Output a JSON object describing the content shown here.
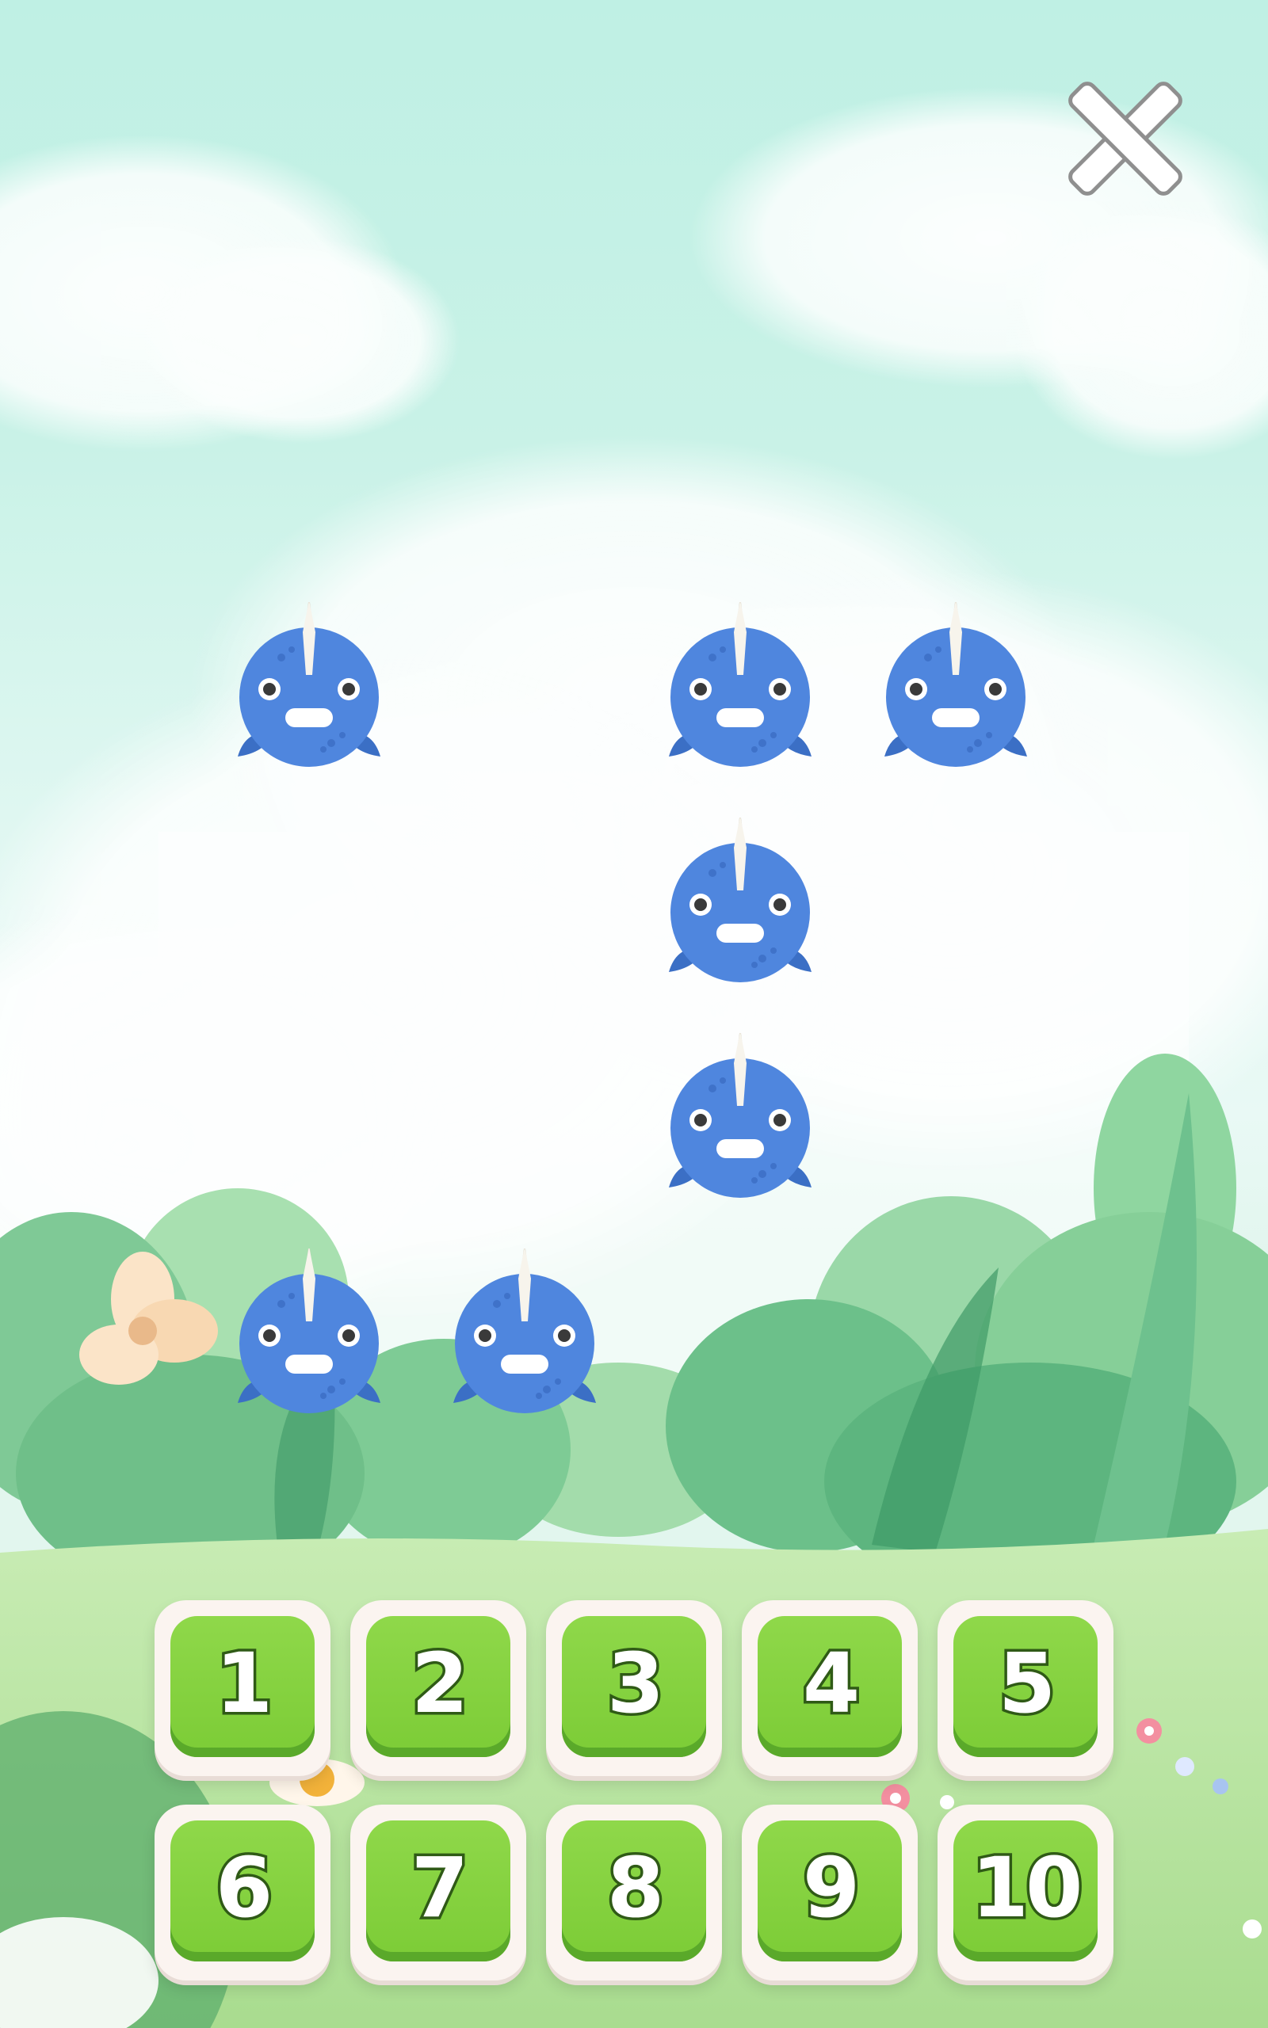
{
  "close": {
    "icon": "close-icon"
  },
  "narwhals": {
    "count": 7,
    "icon": "narwhal-icon"
  },
  "keypad": {
    "keys": [
      "1",
      "2",
      "3",
      "4",
      "5",
      "6",
      "7",
      "8",
      "9",
      "10"
    ]
  },
  "colors": {
    "sky": "#bff0e4",
    "narwhal_body": "#4f86de",
    "key_green": "#86d23f",
    "key_frame": "#fbf4f0"
  }
}
